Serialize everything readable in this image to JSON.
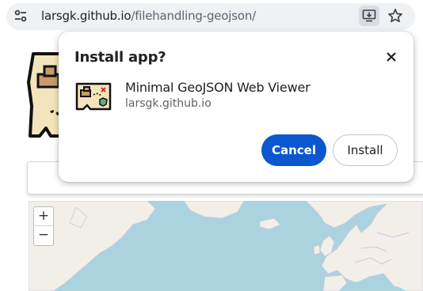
{
  "address_bar": {
    "host": "larsgk.github.io",
    "path": "/filehandling-geojson/",
    "icons": [
      "tune-icon",
      "install-app-icon",
      "bookmark-star-icon"
    ]
  },
  "dialog": {
    "title": "Install app?",
    "app_name": "Minimal GeoJSON Web Viewer",
    "app_origin": "larsgk.github.io",
    "cancel_label": "Cancel",
    "install_label": "Install",
    "accent_color": "#0b57d0"
  },
  "map": {
    "zoom_in_label": "+",
    "zoom_out_label": "−",
    "water_color": "#aad3df",
    "land_color": "#f2efe9"
  }
}
